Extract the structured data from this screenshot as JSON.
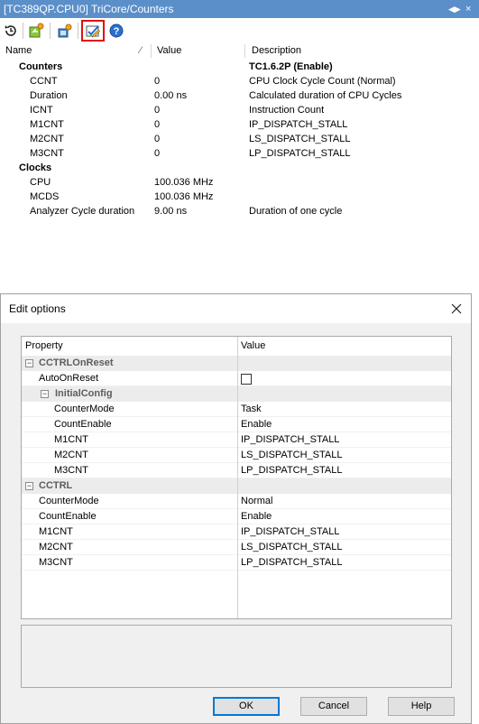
{
  "panel": {
    "title": "[TC389QP.CPU0] TriCore/Counters",
    "toolbar": {
      "items": [
        {
          "icon": "reset-icon"
        },
        {
          "icon": "refresh-icon"
        },
        {
          "icon": "export-icon"
        },
        {
          "icon": "edit-options-icon",
          "active": true
        },
        {
          "icon": "help-icon"
        }
      ]
    },
    "columns": [
      "Name",
      "Value",
      "Description"
    ],
    "rows": [
      {
        "name": "Counters",
        "value": "",
        "description": "TC1.6.2P (Enable)",
        "group": true
      },
      {
        "name": "CCNT",
        "value": "0",
        "description": "CPU Clock Cycle Count (Normal)"
      },
      {
        "name": "Duration",
        "value": "0.00 ns",
        "description": "Calculated duration of CPU Cycles"
      },
      {
        "name": "ICNT",
        "value": "0",
        "description": "Instruction Count"
      },
      {
        "name": "M1CNT",
        "value": "0",
        "description": "IP_DISPATCH_STALL"
      },
      {
        "name": "M2CNT",
        "value": "0",
        "description": "LS_DISPATCH_STALL"
      },
      {
        "name": "M3CNT",
        "value": "0",
        "description": "LP_DISPATCH_STALL"
      },
      {
        "name": "Clocks",
        "value": "",
        "description": "",
        "group": true
      },
      {
        "name": "CPU",
        "value": "100.036 MHz",
        "description": ""
      },
      {
        "name": "MCDS",
        "value": "100.036 MHz",
        "description": ""
      },
      {
        "name": "Analyzer Cycle duration",
        "value": "9.00 ns",
        "description": "Duration of one cycle"
      }
    ]
  },
  "dialog": {
    "title": "Edit options",
    "columns": [
      "Property",
      "Value"
    ],
    "rows": [
      {
        "label": "CCTRLOnReset",
        "value": "",
        "type": "category",
        "expander": "⊟"
      },
      {
        "label": "AutoOnReset",
        "value": "",
        "type": "checkbox"
      },
      {
        "label": "InitialConfig",
        "value": "",
        "type": "subcategory",
        "expander": "⊟"
      },
      {
        "label": "CounterMode",
        "value": "Task",
        "type": "property2"
      },
      {
        "label": "CountEnable",
        "value": "Enable",
        "type": "property2"
      },
      {
        "label": "M1CNT",
        "value": "IP_DISPATCH_STALL",
        "type": "property2"
      },
      {
        "label": "M2CNT",
        "value": "LS_DISPATCH_STALL",
        "type": "property2"
      },
      {
        "label": "M3CNT",
        "value": "LP_DISPATCH_STALL",
        "type": "property2"
      },
      {
        "label": "CCTRL",
        "value": "",
        "type": "category",
        "expander": "⊟"
      },
      {
        "label": "CounterMode",
        "value": "Normal",
        "type": "property"
      },
      {
        "label": "CountEnable",
        "value": "Enable",
        "type": "property"
      },
      {
        "label": "M1CNT",
        "value": "IP_DISPATCH_STALL",
        "type": "property"
      },
      {
        "label": "M2CNT",
        "value": "LS_DISPATCH_STALL",
        "type": "property"
      },
      {
        "label": "M3CNT",
        "value": "LP_DISPATCH_STALL",
        "type": "property"
      }
    ],
    "buttons": {
      "ok": "OK",
      "cancel": "Cancel",
      "help": "Help"
    }
  },
  "colors": {
    "title_bar": "#5b8fc9",
    "highlight_border": "#e01010",
    "default_button_border": "#0078d7"
  }
}
